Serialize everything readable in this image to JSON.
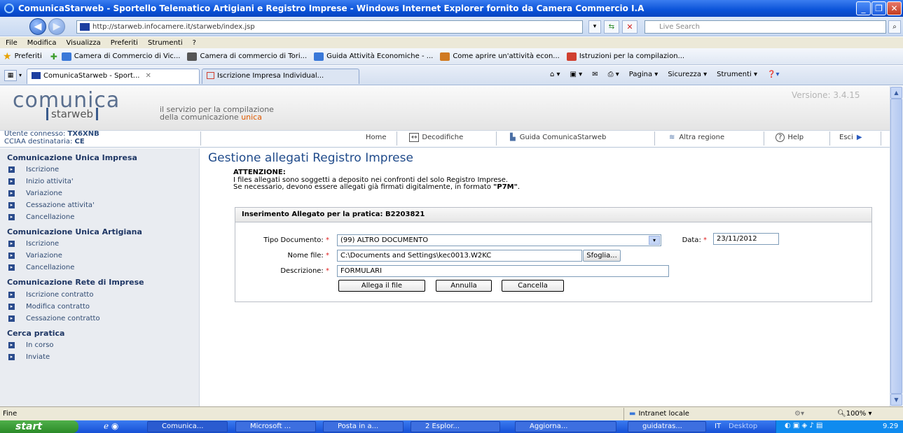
{
  "window": {
    "title": "ComunicaStarweb - Sportello Telematico Artigiani e Registro Imprese - Windows Internet Explorer fornito da Camera Commercio I.A"
  },
  "address": {
    "url": "http://starweb.infocamere.it/starweb/index.jsp",
    "search_placeholder": "Live Search"
  },
  "menu": [
    "File",
    "Modifica",
    "Visualizza",
    "Preferiti",
    "Strumenti",
    "?"
  ],
  "favorites": {
    "label": "Preferiti",
    "items": [
      "Camera di Commercio di Vic...",
      "Camera di commercio di Tori...",
      "Guida Attività Economiche - ...",
      "Come aprire un'attività econ...",
      "Istruzioni per la compilazion..."
    ]
  },
  "tabs": [
    "ComunicaStarweb - Sport...",
    "Iscrizione Impresa Individual..."
  ],
  "tab_tools": [
    "Pagina",
    "Sicurezza",
    "Strumenti"
  ],
  "app": {
    "logo_top": "comunica",
    "logo_bottom": "starweb",
    "tagline_1": "il servizio per la compilazione",
    "tagline_2_prefix": "della comunicazione ",
    "tagline_2_em": "unica",
    "version": "Versione: 3.4.15"
  },
  "user": {
    "label1": "Utente connesso: ",
    "name": "TX6XNB",
    "label2": "CCIAA destinataria: ",
    "cciaa": "CE"
  },
  "topnav": [
    "Home",
    "Decodifiche",
    "Guida ComunicaStarweb",
    "Altra regione",
    "Help",
    "Esci"
  ],
  "sidebar": [
    {
      "heading": "Comunicazione Unica Impresa",
      "items": [
        "Iscrizione",
        "Inizio attivita'",
        "Variazione",
        "Cessazione attivita'",
        "Cancellazione"
      ]
    },
    {
      "heading": "Comunicazione Unica Artigiana",
      "items": [
        "Iscrizione",
        "Variazione",
        "Cancellazione"
      ]
    },
    {
      "heading": "Comunicazione Rete di Imprese",
      "items": [
        "Iscrizione contratto",
        "Modifica contratto",
        "Cessazione contratto"
      ]
    },
    {
      "heading": "Cerca pratica",
      "items": [
        "In corso",
        "Inviate"
      ]
    }
  ],
  "main": {
    "title": "Gestione allegati Registro Imprese",
    "attention_heading": "ATTENZIONE:",
    "attention_line1": "I files allegati sono soggetti a deposito nei confronti del solo Registro Imprese.",
    "attention_line2_prefix": "Se necessario, devono essere allegati già firmati digitalmente, in formato ",
    "attention_line2_format": "\"P7M\"",
    "attention_line2_suffix": ".",
    "form_heading": "Inserimento Allegato per la pratica: B2203821",
    "tipo_label": "Tipo Documento:",
    "tipo_value": "(99) ALTRO DOCUMENTO",
    "data_label": "Data:",
    "data_value": "23/11/2012",
    "file_label": "Nome file:",
    "file_value": "C:\\Documents and Settings\\kec0013.W2KC",
    "browse_label": "Sfoglia...",
    "desc_label": "Descrizione:",
    "desc_value": "FORMULARI",
    "btn_attach": "Allega il file",
    "btn_cancel": "Annulla",
    "btn_delete": "Cancella"
  },
  "status": {
    "left": "Fine",
    "zone": "Intranet locale",
    "zoom": "100%"
  },
  "taskbar": {
    "start": "start",
    "tasks": [
      "Comunica...",
      "Microsoft ...",
      "Posta in a...",
      "2 Esplor...",
      "Aggiorna...",
      "guidatras..."
    ],
    "lang": "IT",
    "desktop": "Desktop",
    "clock": "9.29"
  }
}
